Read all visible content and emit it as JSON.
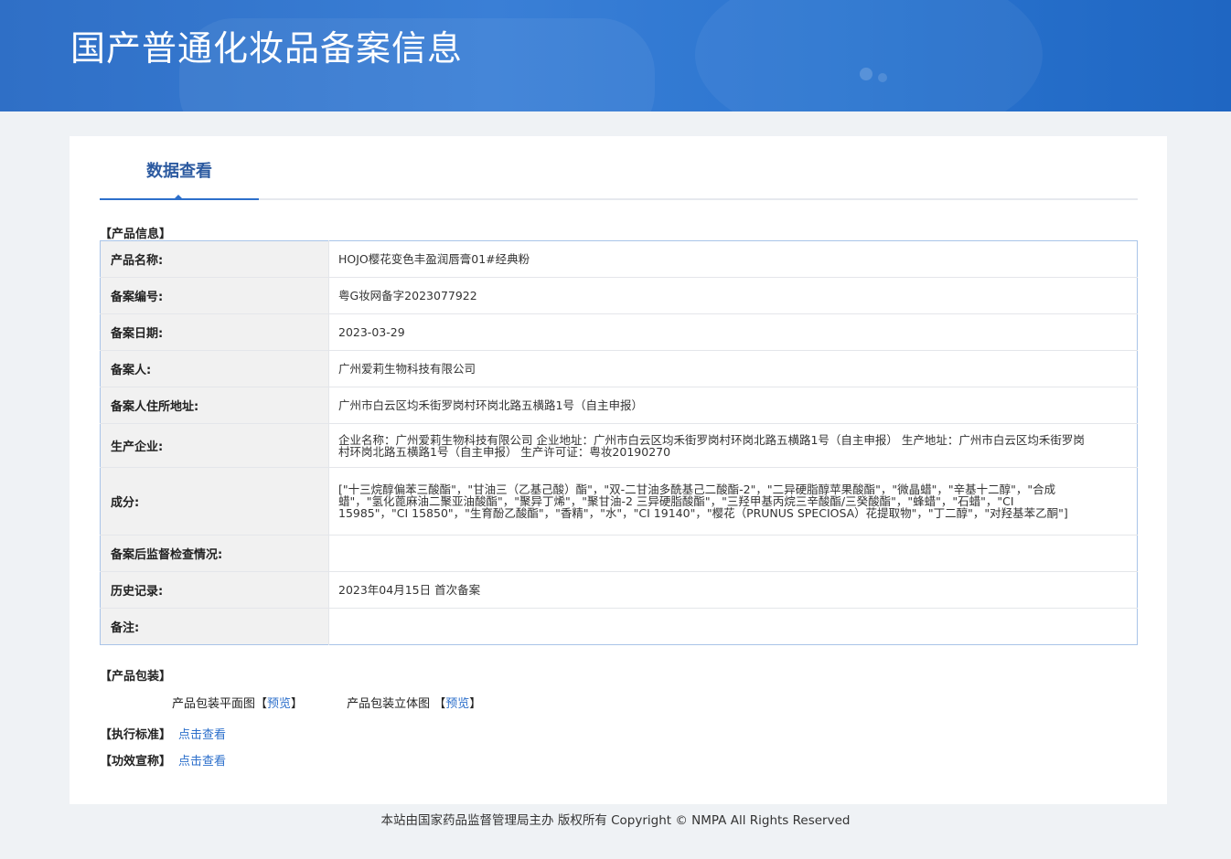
{
  "header": {
    "title": "国产普通化妆品备案信息"
  },
  "tabs": [
    {
      "label": "数据查看"
    }
  ],
  "product_info": {
    "section_title": "【产品信息】",
    "rows": [
      {
        "label": "产品名称:",
        "value": "HOJO樱花变色丰盈润唇膏01#经典粉"
      },
      {
        "label": "备案编号:",
        "value": "粤G妆网备字2023077922"
      },
      {
        "label": "备案日期:",
        "value": "2023-03-29"
      },
      {
        "label": "备案人:",
        "value": "广州爱莉生物科技有限公司"
      },
      {
        "label": "备案人住所地址:",
        "value": "广州市白云区均禾街罗岗村环岗北路五横路1号（自主申报）"
      },
      {
        "label": "生产企业:",
        "value": "企业名称：广州爱莉生物科技有限公司 企业地址：广州市白云区均禾街罗岗村环岗北路五横路1号（自主申报） 生产地址：广州市白云区均禾街罗岗村环岗北路五横路1号（自主申报） 生产许可证：粤妆20190270"
      },
      {
        "label": "成分:",
        "value": "[\"十三烷醇偏苯三酸酯\"，\"甘油三（乙基己酸）酯\"，\"双-二甘油多酰基己二酸酯-2\"，\"二异硬脂醇苹果酸酯\"，\"微晶蜡\"，\"辛基十二醇\"，\"合成蜡\"，\"氢化蓖麻油二聚亚油酸酯\"，\"聚异丁烯\"，\"聚甘油-2 三异硬脂酸酯\"，\"三羟甲基丙烷三辛酸酯/三癸酸酯\"，\"蜂蜡\"，\"石蜡\"，\"CI 15985\"，\"CI 15850\"，\"生育酚乙酸酯\"，\"香精\"，\"水\"，\"CI 19140\"，\"樱花（PRUNUS SPECIOSA）花提取物\"，\"丁二醇\"，\"对羟基苯乙酮\"]"
      },
      {
        "label": "备案后监督检查情况:",
        "value": ""
      },
      {
        "label": "历史记录:",
        "value": "2023年04月15日 首次备案"
      },
      {
        "label": "备注:",
        "value": ""
      }
    ]
  },
  "packaging": {
    "section_title": "【产品包装】",
    "flat_label": "产品包装平面图",
    "flat_link": "预览",
    "solid_label": "产品包装立体图",
    "solid_link": "预览"
  },
  "standard": {
    "label": "【执行标准】",
    "link": "点击查看"
  },
  "efficacy": {
    "label": "【功效宣称】",
    "link": "点击查看"
  },
  "footer": {
    "text": "本站由国家药品监督管理局主办 版权所有 Copyright © NMPA All Rights Reserved"
  },
  "colors": {
    "banner": "#2f6fc6",
    "accent": "#2c6fcb",
    "label_bg": "#f1f1f1",
    "page_bg": "#eff2f5"
  }
}
